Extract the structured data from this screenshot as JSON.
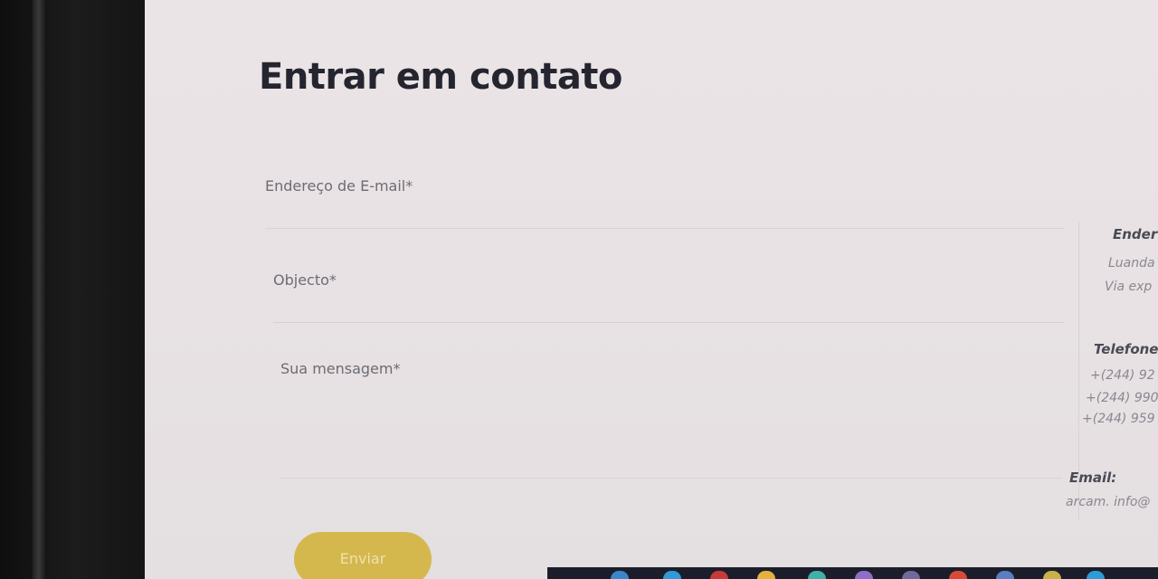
{
  "form": {
    "title": "Entrar em contato",
    "email_label": "Endereço de E-mail*",
    "subject_label": "Objecto*",
    "message_label": "Sua mensagem*",
    "submit_label": "Enviar"
  },
  "info": {
    "address_heading": "Ender",
    "address_line1": "Luanda",
    "address_line2": "Via exp",
    "phone_heading": "Telefone:",
    "phones": [
      "+(244) 92",
      "+(244) 990",
      "+(244) 959"
    ],
    "email_heading": "Email:",
    "email_value": "arcam. info@"
  },
  "colors": {
    "accent": "#d4b84e",
    "background": "#ebe4e6",
    "title": "#252530"
  },
  "taskbar": {
    "icons": [
      "cortana-icon",
      "task-view-icon",
      "edge-icon",
      "opera-icon",
      "folder-icon",
      "chrome-icon",
      "store-icon",
      "photos-icon",
      "chrome-icon",
      "app-icon",
      "app-icon",
      "app-icon"
    ]
  }
}
